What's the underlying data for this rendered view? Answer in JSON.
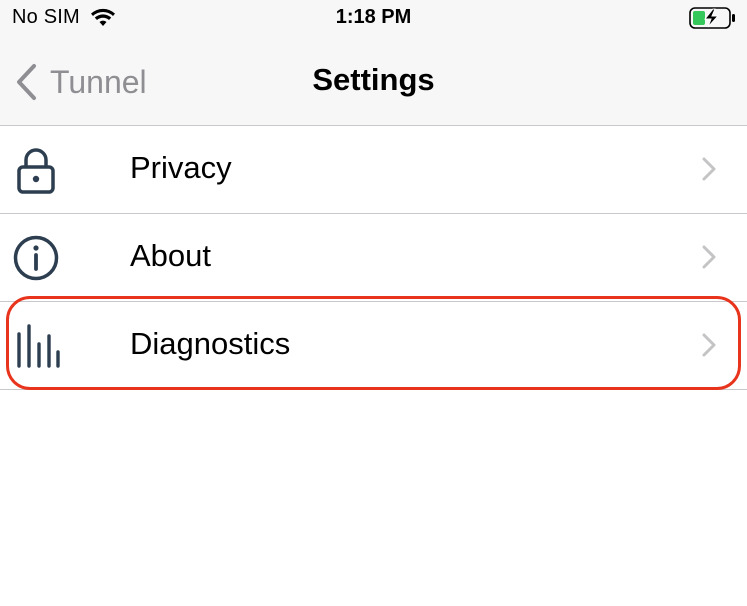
{
  "status_bar": {
    "carrier": "No SIM",
    "time": "1:18 PM",
    "icons": [
      "wifi-icon",
      "battery-charging-icon"
    ]
  },
  "nav_bar": {
    "back_label": "Tunnel",
    "title": "Settings"
  },
  "settings_list": {
    "items": [
      {
        "label": "Privacy",
        "icon": "lock-icon"
      },
      {
        "label": "About",
        "icon": "info-icon"
      },
      {
        "label": "Diagnostics",
        "icon": "diagnostics-icon",
        "highlighted": true
      }
    ]
  },
  "colors": {
    "highlight": "#e8341c",
    "icon": "#2c3e50",
    "chevron": "#c4c4c7",
    "back": "#8e8e93",
    "battery_fill": "#34c759"
  }
}
